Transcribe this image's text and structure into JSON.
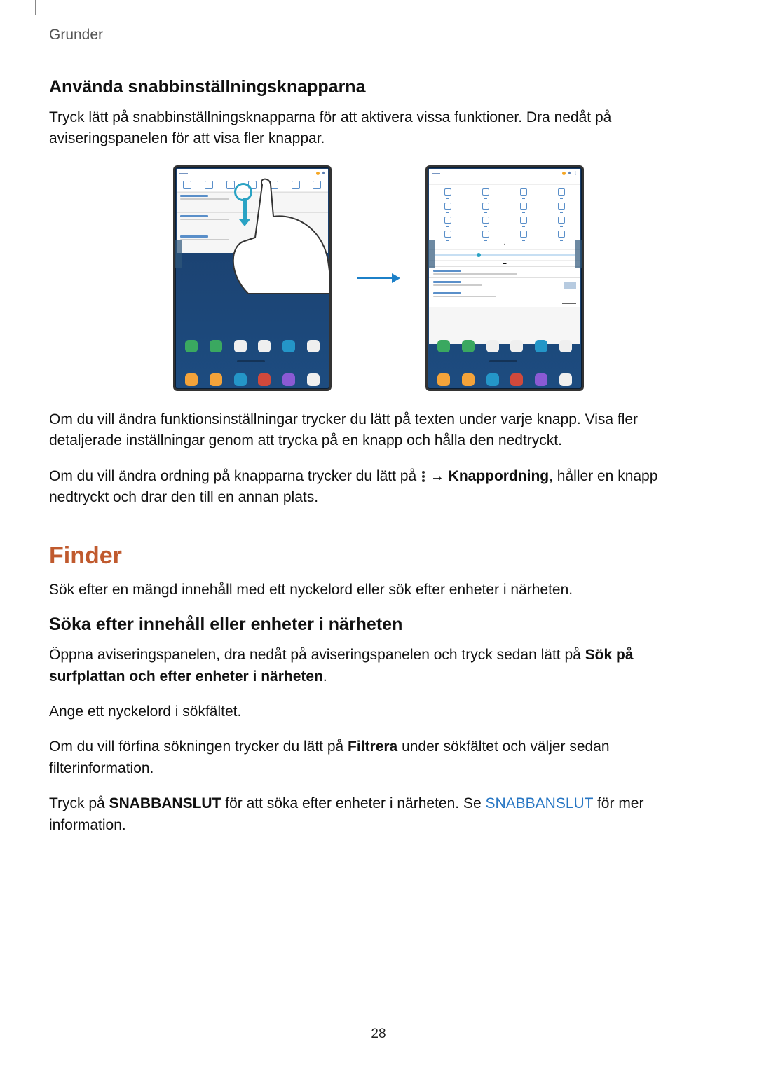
{
  "header": "Grunder",
  "section1_title": "Använda snabbinställningsknapparna",
  "section1_p1": "Tryck lätt på snabbinställningsknapparna för att aktivera vissa funktioner. Dra nedåt på aviseringspanelen för att visa fler knappar.",
  "section1_p2": "Om du vill ändra funktionsinställningar trycker du lätt på texten under varje knapp. Visa fler detaljerade inställningar genom att trycka på en knapp och hålla den nedtryckt.",
  "section1_p3_a": "Om du vill ändra ordning på knapparna trycker du lätt på ",
  "section1_p3_b": " → ",
  "section1_p3_bold": "Knappordning",
  "section1_p3_c": ", håller en knapp nedtryckt och drar den till en annan plats.",
  "finder_title": "Finder",
  "finder_intro": "Sök efter en mängd innehåll med ett nyckelord eller sök efter enheter i närheten.",
  "section2_title": "Söka efter innehåll eller enheter i närheten",
  "section2_p1_a": "Öppna aviseringspanelen, dra nedåt på aviseringspanelen och tryck sedan lätt på ",
  "section2_p1_bold": "Sök på surfplattan och efter enheter i närheten",
  "section2_p1_b": ".",
  "section2_p2": "Ange ett nyckelord i sökfältet.",
  "section2_p3_a": "Om du vill förfina sökningen trycker du lätt på ",
  "section2_p3_bold": "Filtrera",
  "section2_p3_b": " under sökfältet och väljer sedan filterinformation.",
  "section2_p4_a": "Tryck på ",
  "section2_p4_bold": "SNABBANSLUT",
  "section2_p4_b": " för att söka efter enheter i närheten. Se ",
  "section2_p4_link": "SNABBANSLUT",
  "section2_p4_c": " för mer information.",
  "page_number": "28"
}
